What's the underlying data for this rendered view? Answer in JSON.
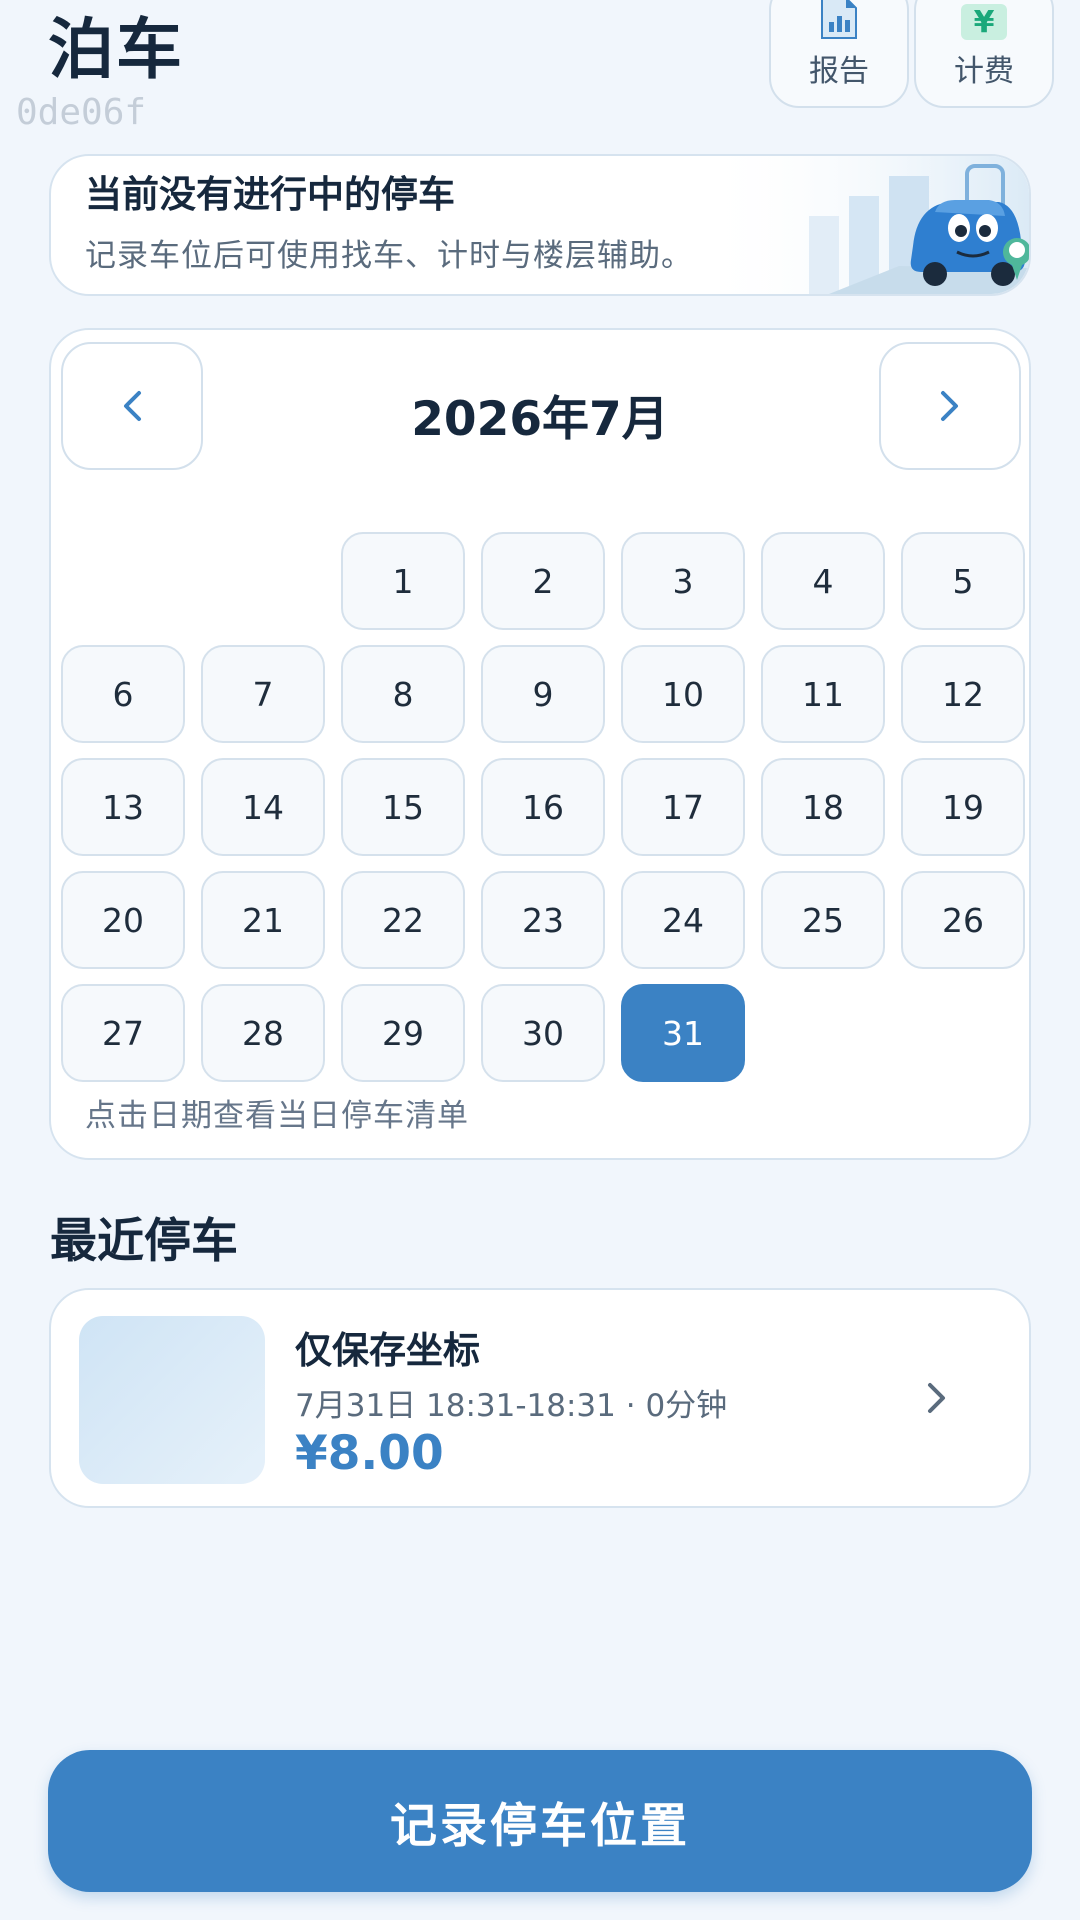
{
  "header": {
    "title": "泊车",
    "build_id": "0de06f",
    "report_label": "报告",
    "fee_label": "计费",
    "fee_icon_glyph": "¥"
  },
  "banner": {
    "title": "当前没有进行中的停车",
    "subtitle": "记录车位后可使用找车、计时与楼层辅助。"
  },
  "calendar": {
    "month_label": "2026年7月",
    "first_weekday_index": 2,
    "days": [
      "1",
      "2",
      "3",
      "4",
      "5",
      "6",
      "7",
      "8",
      "9",
      "10",
      "11",
      "12",
      "13",
      "14",
      "15",
      "16",
      "17",
      "18",
      "19",
      "20",
      "21",
      "22",
      "23",
      "24",
      "25",
      "26",
      "27",
      "28",
      "29",
      "30",
      "31"
    ],
    "selected_day": "31",
    "hint": "点击日期查看当日停车清单"
  },
  "recent": {
    "section_title": "最近停车",
    "items": [
      {
        "title": "仅保存坐标",
        "subtitle": "7月31日 18:31-18:31 · 0分钟",
        "price": "¥8.00"
      }
    ]
  },
  "footer": {
    "record_button": "记录停车位置"
  },
  "colors": {
    "accent": "#3b82c4",
    "background": "#f1f6fc",
    "fee_green": "#1aa87a"
  }
}
